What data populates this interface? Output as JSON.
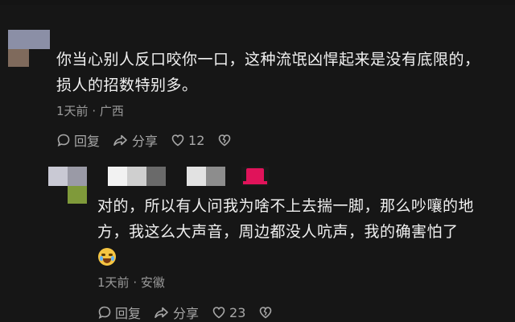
{
  "comment": {
    "text_line1": "你当心别人反口咬你一口，这种流氓凶悍起来是没有底限的，",
    "text_line2": "损人的招数特别多。",
    "time": "1天前",
    "separator": "·",
    "location": "广西",
    "reply_label": "回复",
    "share_label": "分享",
    "like_count": "12"
  },
  "reply": {
    "text_line1": "对的，所以有人问我为啥不上去揣一脚，那么吵嚷的地",
    "text_line2": "方，我这么大声音，周边都没人吭声，我的确害怕了",
    "time": "1天前",
    "separator": "·",
    "location": "安徽",
    "reply_label": "回复",
    "share_label": "分享",
    "like_count": "23"
  },
  "colors": {
    "background": "#161616",
    "text": "#f0f0f0",
    "meta": "#9a9a9a",
    "action": "#a8a8a8"
  },
  "icons": [
    "comment-icon",
    "share-icon",
    "heart-icon",
    "broken-heart-icon",
    "crying-emoji-icon"
  ]
}
